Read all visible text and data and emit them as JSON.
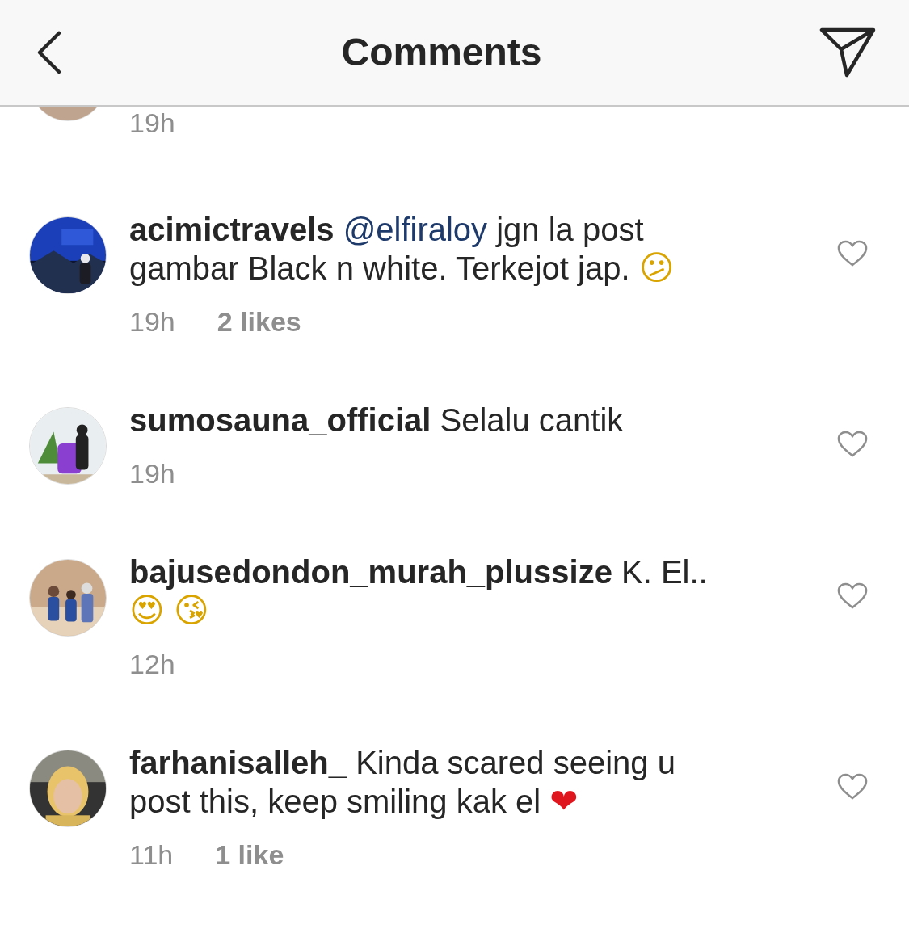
{
  "header": {
    "title": "Comments"
  },
  "comments": [
    {
      "time": "19h"
    },
    {
      "segments": [
        {
          "kind": "username",
          "text": "acimictravels"
        },
        {
          "kind": "mention",
          "text": "@elfiraloy"
        },
        {
          "kind": "text",
          "text": "jgn la post gambar Black n white. Terkejot jap."
        },
        {
          "kind": "emoji",
          "text": "😕",
          "color": "#d9a400"
        }
      ],
      "time": "19h",
      "likes": "2 likes"
    },
    {
      "segments": [
        {
          "kind": "username",
          "text": "sumosauna_official"
        },
        {
          "kind": "text",
          "text": "Selalu cantik"
        }
      ],
      "time": "19h"
    },
    {
      "segments": [
        {
          "kind": "username",
          "text": "bajusedondon_murah_plussize"
        },
        {
          "kind": "text",
          "text": "K. El.."
        },
        {
          "kind": "emoji",
          "text": "😍",
          "color": "#d9a400"
        },
        {
          "kind": "emoji",
          "text": "😘",
          "color": "#d9a400"
        }
      ],
      "time": "12h"
    },
    {
      "segments": [
        {
          "kind": "username",
          "text": "farhanisalleh_"
        },
        {
          "kind": "text",
          "text": "Kinda scared seeing u post this, keep smiling kak el"
        },
        {
          "kind": "emoji",
          "text": "❤",
          "color": "#e0161e"
        }
      ],
      "time": "11h",
      "likes": "1 like"
    }
  ]
}
